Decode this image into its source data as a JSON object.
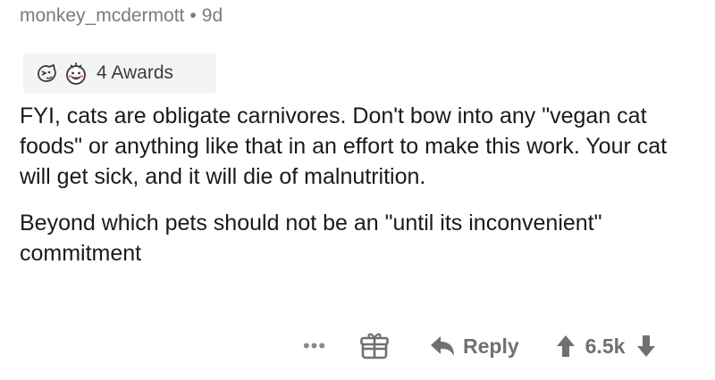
{
  "comment": {
    "author": "monkey_mcdermott",
    "separator": "•",
    "age": "9d",
    "awards_label": "4 Awards",
    "award_icons": [
      "silver-award-icon",
      "wholesome-award-icon"
    ],
    "paragraphs": [
      "FYI, cats are obligate carnivores.  Don't bow into any \"vegan cat foods\" or anything like that in an effort to make this work.  Your cat will get sick, and it will die of malnutrition.",
      "Beyond which pets should not be an \"until its inconvenient\" commitment"
    ]
  },
  "actions": {
    "more_label": "•••",
    "reply_label": "Reply",
    "score": "6.5k"
  },
  "colors": {
    "meta_text": "#787c7e",
    "body_text": "#1a1a1b",
    "action_text": "#6e7173",
    "awards_bg": "#f4f4f5"
  }
}
